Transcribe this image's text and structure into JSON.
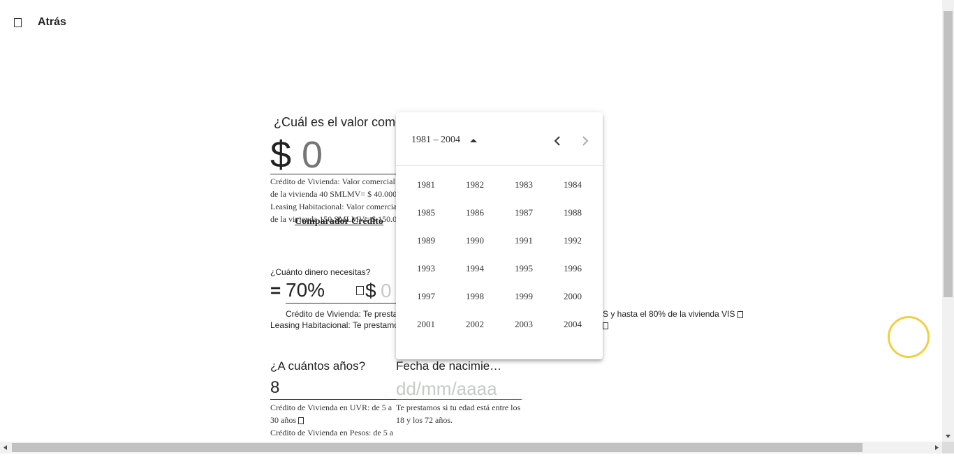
{
  "header": {
    "back_label": "Atrás"
  },
  "value_section": {
    "question": "¿Cuál es el valor come",
    "currency": "$",
    "placeholder": "0",
    "notes": [
      "Crédito de Vivienda: Valor comercial",
      "de la vivienda 40 SMLMV= $ 40.000",
      "Leasing Habitacional: Valor comercia",
      "de la vivienda 150 SMLMV= $ 150.0"
    ],
    "comparador_link": "Comparador Crédito"
  },
  "money_section": {
    "question": "¿Cuánto dinero necesitas?",
    "equals": "=",
    "percent": "70%",
    "currency": "$",
    "placeholder": "0",
    "credito_text": "Crédito de Vivienda: Te prestamos",
    "credito_text_end": "S y hasta el 80% de la vivienda VIS",
    "leasing_text": "Leasing Habitacional: Te prestamos"
  },
  "years_section": {
    "question": "¿A cuántos años?",
    "value": "8",
    "notes": [
      "Crédito de Vivienda en UVR: de 5 a",
      "30 años",
      "Crédito de Vivienda en Pesos: de 5 a"
    ]
  },
  "birth_section": {
    "label": "Fecha de nacimie…",
    "placeholder": "dd/mm/aaaa",
    "notes": [
      "Te prestamos si tu edad está entre los",
      "18 y los 72 años."
    ]
  },
  "datepicker": {
    "period_label": "1981 – 2004",
    "years": [
      "1981",
      "1982",
      "1983",
      "1984",
      "1985",
      "1986",
      "1987",
      "1988",
      "1989",
      "1990",
      "1991",
      "1992",
      "1993",
      "1994",
      "1995",
      "1996",
      "1997",
      "1998",
      "1999",
      "2000",
      "2001",
      "2002",
      "2003",
      "2004"
    ]
  },
  "icons": {
    "back": "back-arrow-icon",
    "prev": "chevron-left-icon",
    "next": "chevron-right-icon",
    "period": "caret-up-icon"
  }
}
